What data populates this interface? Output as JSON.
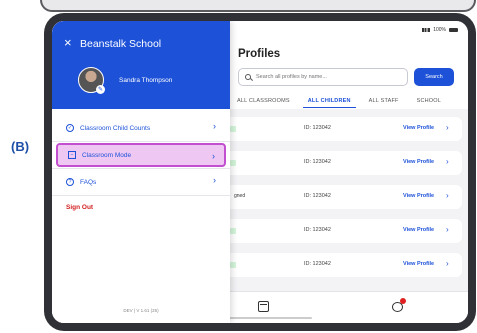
{
  "annotation": {
    "step_label": "(B)"
  },
  "status": {
    "battery": "100%"
  },
  "main": {
    "title": "Profiles",
    "search": {
      "placeholder": "Search all profiles by name...",
      "button": "Search"
    },
    "tabs": [
      {
        "label": "ALL CLASSROOMS",
        "active": false
      },
      {
        "label": "ALL CHILDREN",
        "active": true
      },
      {
        "label": "ALL STAFF",
        "active": false
      },
      {
        "label": "SCHOOL",
        "active": false
      }
    ],
    "rows": [
      {
        "tag": "",
        "id": "ID: 123042",
        "action": "View Profile"
      },
      {
        "tag": "",
        "id": "ID: 123042",
        "action": "View Profile"
      },
      {
        "tag": "gned",
        "id": "ID: 123042",
        "action": "View Profile"
      },
      {
        "tag": "",
        "id": "ID: 123042",
        "action": "View Profile"
      },
      {
        "tag": "",
        "id": "ID: 123042",
        "action": "View Profile"
      }
    ]
  },
  "drawer": {
    "school_name": "Beanstalk School",
    "user_name": "Sandra Thompson",
    "menu": [
      {
        "label": "Classroom Child Counts",
        "icon": "check-circle-icon",
        "highlighted": false
      },
      {
        "label": "Classroom Mode",
        "icon": "monitor-icon",
        "highlighted": true
      },
      {
        "label": "FAQs",
        "icon": "help-circle-icon",
        "highlighted": false
      }
    ],
    "sign_out": "Sign Out",
    "version": "DEV  |  V 1.61 (25)"
  },
  "colors": {
    "primary": "#1c51d8",
    "highlight_fill": "#eec8f2",
    "highlight_border": "#c24ed0",
    "danger": "#d21d1d",
    "label": "#1e4fa6"
  }
}
